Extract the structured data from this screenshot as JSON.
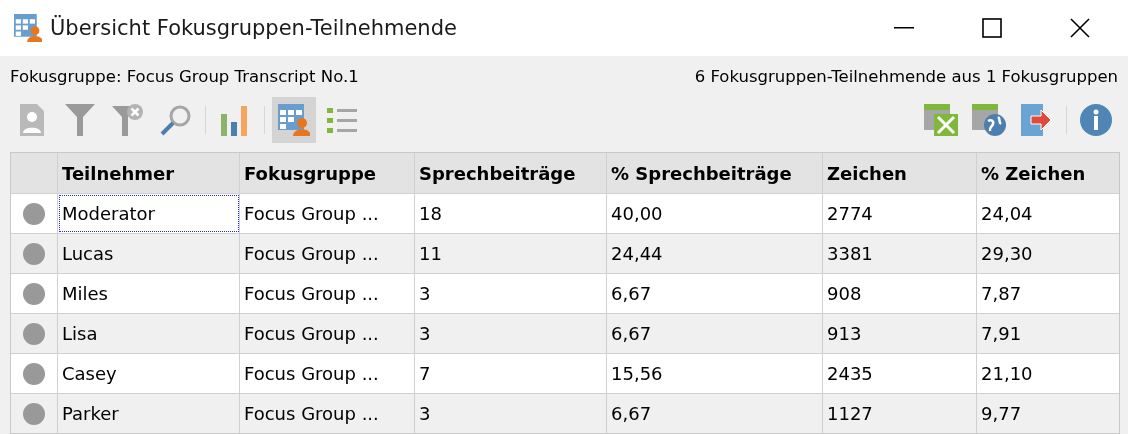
{
  "window": {
    "title": "Übersicht Fokusgruppen-Teilnehmende"
  },
  "info_bar": {
    "group": "Fokusgruppe: Focus Group Transcript No.1",
    "summary": "6 Fokusgruppen-Teilnehmende aus 1 Fokusgruppen"
  },
  "toolbar_left": [
    {
      "kind": "person-doc",
      "selected": false
    },
    {
      "kind": "filter",
      "selected": false
    },
    {
      "kind": "filter-clear",
      "selected": false
    },
    {
      "kind": "search",
      "selected": false
    },
    {
      "kind": "separator"
    },
    {
      "kind": "chart",
      "selected": false
    },
    {
      "kind": "separator"
    },
    {
      "kind": "table-person",
      "selected": true
    },
    {
      "kind": "list",
      "selected": false
    }
  ],
  "toolbar_right": [
    {
      "kind": "excel"
    },
    {
      "kind": "web"
    },
    {
      "kind": "exit"
    },
    {
      "kind": "separator"
    },
    {
      "kind": "info"
    }
  ],
  "table": {
    "columns": [
      "Teilnehmer",
      "Fokusgruppe",
      "Sprechbeiträge",
      "% Sprechbeiträge",
      "Zeichen",
      "% Zeichen"
    ],
    "rows": [
      {
        "color": "#999999",
        "focused": true,
        "cells": [
          "Moderator",
          "Focus Group ...",
          "18",
          "40,00",
          "2774",
          "24,04"
        ]
      },
      {
        "color": "#999999",
        "focused": false,
        "cells": [
          "Lucas",
          "Focus Group ...",
          "11",
          "24,44",
          "3381",
          "29,30"
        ]
      },
      {
        "color": "#999999",
        "focused": false,
        "cells": [
          "Miles",
          "Focus Group ...",
          "3",
          "6,67",
          "908",
          "7,87"
        ]
      },
      {
        "color": "#999999",
        "focused": false,
        "cells": [
          "Lisa",
          "Focus Group ...",
          "3",
          "6,67",
          "913",
          "7,91"
        ]
      },
      {
        "color": "#999999",
        "focused": false,
        "cells": [
          "Casey",
          "Focus Group ...",
          "7",
          "15,56",
          "2435",
          "21,10"
        ]
      },
      {
        "color": "#999999",
        "focused": false,
        "cells": [
          "Parker",
          "Focus Group ...",
          "3",
          "6,67",
          "1127",
          "9,77"
        ]
      }
    ]
  }
}
